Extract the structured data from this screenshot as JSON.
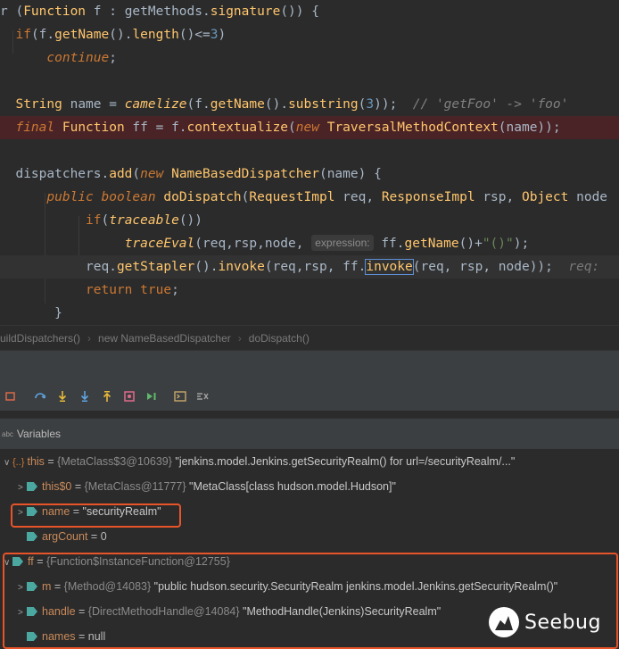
{
  "editor": {
    "lines": [
      {
        "segs": [
          [
            "plain",
            "r ("
          ],
          [
            "type",
            "Function"
          ],
          [
            "plain",
            " f : getMethods."
          ],
          [
            "fn",
            "signature"
          ],
          [
            "plain",
            "()) {"
          ]
        ]
      },
      {
        "segs": [
          [
            "plain",
            "  "
          ],
          [
            "kw",
            "if"
          ],
          [
            "plain",
            "(f."
          ],
          [
            "fn",
            "getName"
          ],
          [
            "plain",
            "()."
          ],
          [
            "fn",
            "length"
          ],
          [
            "plain",
            "()<="
          ],
          [
            "num",
            "3"
          ],
          [
            "plain",
            ")"
          ]
        ]
      },
      {
        "segs": [
          [
            "plain",
            "      "
          ],
          [
            "kwi",
            "continue"
          ],
          [
            "plain",
            ";"
          ]
        ]
      },
      {
        "segs": []
      },
      {
        "segs": [
          [
            "plain",
            "  "
          ],
          [
            "type",
            "String"
          ],
          [
            "plain",
            " name = "
          ],
          [
            "fni",
            "camelize"
          ],
          [
            "plain",
            "(f."
          ],
          [
            "fn",
            "getName"
          ],
          [
            "plain",
            "()."
          ],
          [
            "fn",
            "substring"
          ],
          [
            "plain",
            "("
          ],
          [
            "num",
            "3"
          ],
          [
            "plain",
            "));  "
          ],
          [
            "cmt",
            "// 'getFoo' -> 'foo'"
          ]
        ]
      },
      {
        "segs": [
          [
            "plain",
            "  "
          ],
          [
            "kwi",
            "final"
          ],
          [
            "plain",
            " "
          ],
          [
            "type",
            "Function"
          ],
          [
            "plain",
            " ff = f."
          ],
          [
            "fn",
            "contextualize"
          ],
          [
            "plain",
            "("
          ],
          [
            "kwi",
            "new"
          ],
          [
            "plain",
            " "
          ],
          [
            "type",
            "TraversalMethodContext"
          ],
          [
            "plain",
            "(name));"
          ]
        ]
      },
      {
        "segs": []
      },
      {
        "segs": [
          [
            "plain",
            "  dispatchers."
          ],
          [
            "fn",
            "add"
          ],
          [
            "plain",
            "("
          ],
          [
            "kwi",
            "new"
          ],
          [
            "plain",
            " "
          ],
          [
            "type",
            "NameBasedDispatcher"
          ],
          [
            "plain",
            "(name) {"
          ]
        ]
      },
      {
        "segs": [
          [
            "plain",
            "      "
          ],
          [
            "kwi",
            "public"
          ],
          [
            "plain",
            " "
          ],
          [
            "kwi",
            "boolean"
          ],
          [
            "plain",
            " "
          ],
          [
            "fn",
            "doDispatch"
          ],
          [
            "plain",
            "("
          ],
          [
            "type",
            "RequestImpl"
          ],
          [
            "plain",
            " req, "
          ],
          [
            "type",
            "ResponseImpl"
          ],
          [
            "plain",
            " rsp, "
          ],
          [
            "type",
            "Object"
          ],
          [
            "plain",
            " node"
          ]
        ]
      },
      {
        "segs": [
          [
            "plain",
            "           "
          ],
          [
            "kw",
            "if"
          ],
          [
            "plain",
            "("
          ],
          [
            "fni",
            "traceable"
          ],
          [
            "plain",
            "())"
          ]
        ]
      },
      {
        "segs": [
          [
            "plain",
            "                "
          ],
          [
            "fni",
            "traceEval"
          ],
          [
            "plain",
            "(req,rsp,node, "
          ],
          [
            "inlay",
            "expression:"
          ],
          [
            "plain",
            " ff."
          ],
          [
            "fn",
            "getName"
          ],
          [
            "plain",
            "()+"
          ],
          [
            "str",
            "\"()\""
          ],
          [
            "plain",
            ");"
          ]
        ]
      },
      {
        "segs": [
          [
            "plain",
            "           req."
          ],
          [
            "fn",
            "getStapler"
          ],
          [
            "plain",
            "()."
          ],
          [
            "fn",
            "invoke"
          ],
          [
            "plain",
            "(req,rsp, ff."
          ],
          [
            "box",
            "invoke"
          ],
          [
            "plain",
            "(req, rsp, node));  "
          ],
          [
            "inlay-tail",
            "req: "
          ]
        ]
      },
      {
        "segs": [
          [
            "plain",
            "           "
          ],
          [
            "kw",
            "return"
          ],
          [
            "plain",
            " "
          ],
          [
            "kw",
            "true"
          ],
          [
            "plain",
            ";"
          ]
        ]
      },
      {
        "segs": [
          [
            "plain",
            "       }"
          ]
        ]
      }
    ]
  },
  "breadcrumb": [
    "uildDispatchers()",
    "new NameBasedDispatcher",
    "doDispatch()"
  ],
  "toolbar": {
    "icons": [
      "frames-icon",
      "step-over-icon",
      "step-into-icon",
      "force-step-into-icon",
      "step-out-icon",
      "drop-frame-icon",
      "run-to-cursor-icon",
      "evaluate-icon",
      "trace-icon"
    ]
  },
  "variables": {
    "title": "Variables",
    "rows": [
      {
        "arrow": "∨",
        "icon": "obj",
        "name": "this",
        "eq": " = ",
        "ref": "{MetaClass$3@10639}",
        "val": " \"jenkins.model.Jenkins.getSecurityRealm() for url=/securityRealm/...\""
      },
      {
        "arrow": ">",
        "icon": "tag",
        "name": "this$0",
        "eq": " = ",
        "ref": "{MetaClass@11777}",
        "val": " \"MetaClass[class hudson.model.Hudson]\""
      },
      {
        "arrow": ">",
        "icon": "tag",
        "name": "name",
        "eq": " = ",
        "ref": "",
        "val": "\"securityRealm\""
      },
      {
        "arrow": "",
        "icon": "tag",
        "name": "argCount",
        "eq": " = ",
        "ref": "",
        "val": "0"
      },
      {
        "arrow": "∨",
        "icon": "tag",
        "name": "ff",
        "eq": " = ",
        "ref": "{Function$InstanceFunction@12755}",
        "val": ""
      },
      {
        "arrow": ">",
        "icon": "tag",
        "name": "m",
        "eq": " = ",
        "ref": "{Method@14083}",
        "val": " \"public hudson.security.SecurityRealm jenkins.model.Jenkins.getSecurityRealm()\""
      },
      {
        "arrow": ">",
        "icon": "tag",
        "name": "handle",
        "eq": " = ",
        "ref": "{DirectMethodHandle@14084}",
        "val": " \"MethodHandle(Jenkins)SecurityRealm\""
      },
      {
        "arrow": "",
        "icon": "tag",
        "name": "names",
        "eq": " = ",
        "ref": "",
        "val": "null"
      }
    ]
  },
  "watermark": {
    "text": "Seebug"
  },
  "colors": {
    "callout": "#e8542a",
    "error_line": "#4a2326",
    "accent_box": "#5e8fd4"
  }
}
